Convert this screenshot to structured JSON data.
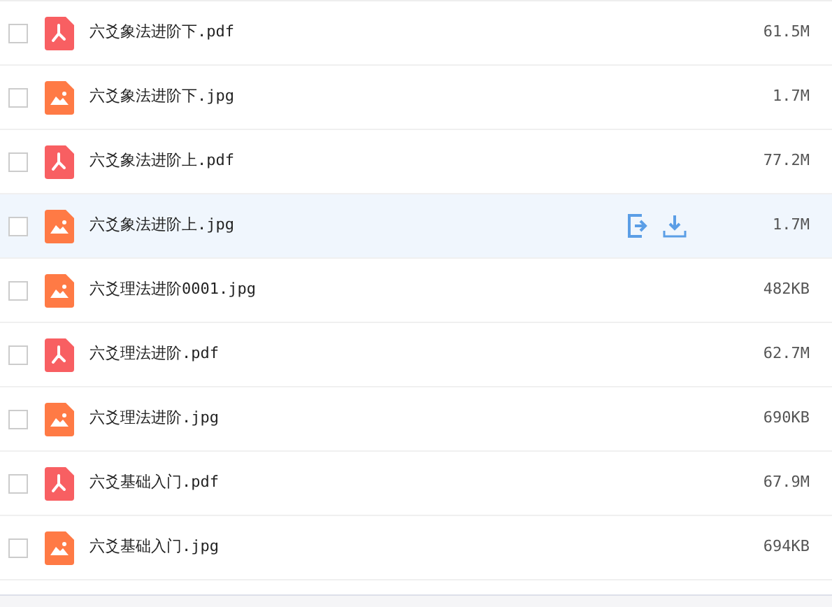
{
  "files": [
    {
      "name": "六爻象法进阶下.pdf",
      "kind": "pdf",
      "size": "61.5M",
      "checked": false,
      "hovered": false
    },
    {
      "name": "六爻象法进阶下.jpg",
      "kind": "image",
      "size": "1.7M",
      "checked": false,
      "hovered": false
    },
    {
      "name": "六爻象法进阶上.pdf",
      "kind": "pdf",
      "size": "77.2M",
      "checked": false,
      "hovered": false
    },
    {
      "name": "六爻象法进阶上.jpg",
      "kind": "image",
      "size": "1.7M",
      "checked": false,
      "hovered": true
    },
    {
      "name": "六爻理法进阶0001.jpg",
      "kind": "image",
      "size": "482KB",
      "checked": false,
      "hovered": false
    },
    {
      "name": "六爻理法进阶.pdf",
      "kind": "pdf",
      "size": "62.7M",
      "checked": false,
      "hovered": false
    },
    {
      "name": "六爻理法进阶.jpg",
      "kind": "image",
      "size": "690KB",
      "checked": false,
      "hovered": false
    },
    {
      "name": "六爻基础入门.pdf",
      "kind": "pdf",
      "size": "67.9M",
      "checked": false,
      "hovered": false
    },
    {
      "name": "六爻基础入门.jpg",
      "kind": "image",
      "size": "694KB",
      "checked": false,
      "hovered": false
    }
  ]
}
